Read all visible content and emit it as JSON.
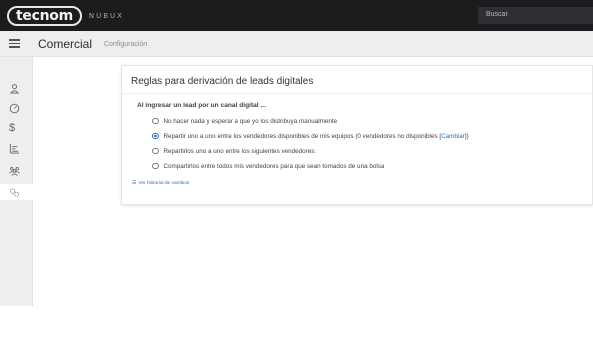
{
  "topbar": {
    "logo_text": "tecnom",
    "logo_sub": "NUBUX",
    "search_placeholder": "Buscar"
  },
  "header": {
    "title": "Comercial",
    "subtitle": "Configuración"
  },
  "sidebar": {
    "items": [
      {
        "icon": "user-icon"
      },
      {
        "icon": "gauge-icon"
      },
      {
        "icon": "dollar-icon"
      },
      {
        "icon": "bar-chart-icon"
      },
      {
        "icon": "team-icon"
      },
      {
        "icon": "settings-icon",
        "active": true
      }
    ]
  },
  "card": {
    "title": "Reglas para derivación de leads digitales",
    "section_label": "Al ingresar un lead por un canal digital ...",
    "options": [
      {
        "label": "No hacer nada y esperar a que yo los distribuya manualmente",
        "checked": false
      },
      {
        "label": "Repartir uno a uno entre los vendedores disponibles de mis equipos (0 vendedores no disponibles [",
        "link": "Cambiar",
        "suffix": "])",
        "checked": true
      },
      {
        "label": "Repartirlos uno a uno entre los siguientes vendedores:",
        "checked": false
      },
      {
        "label": "Compartirlos entre todos mis vendedores para que sean tomados de una bolsa",
        "checked": false
      }
    ],
    "history_link": "Ver historial de cambios"
  },
  "colors": {
    "topbar": "#1b1c1e",
    "header": "#eeeeee",
    "link": "#2f6fb8"
  }
}
